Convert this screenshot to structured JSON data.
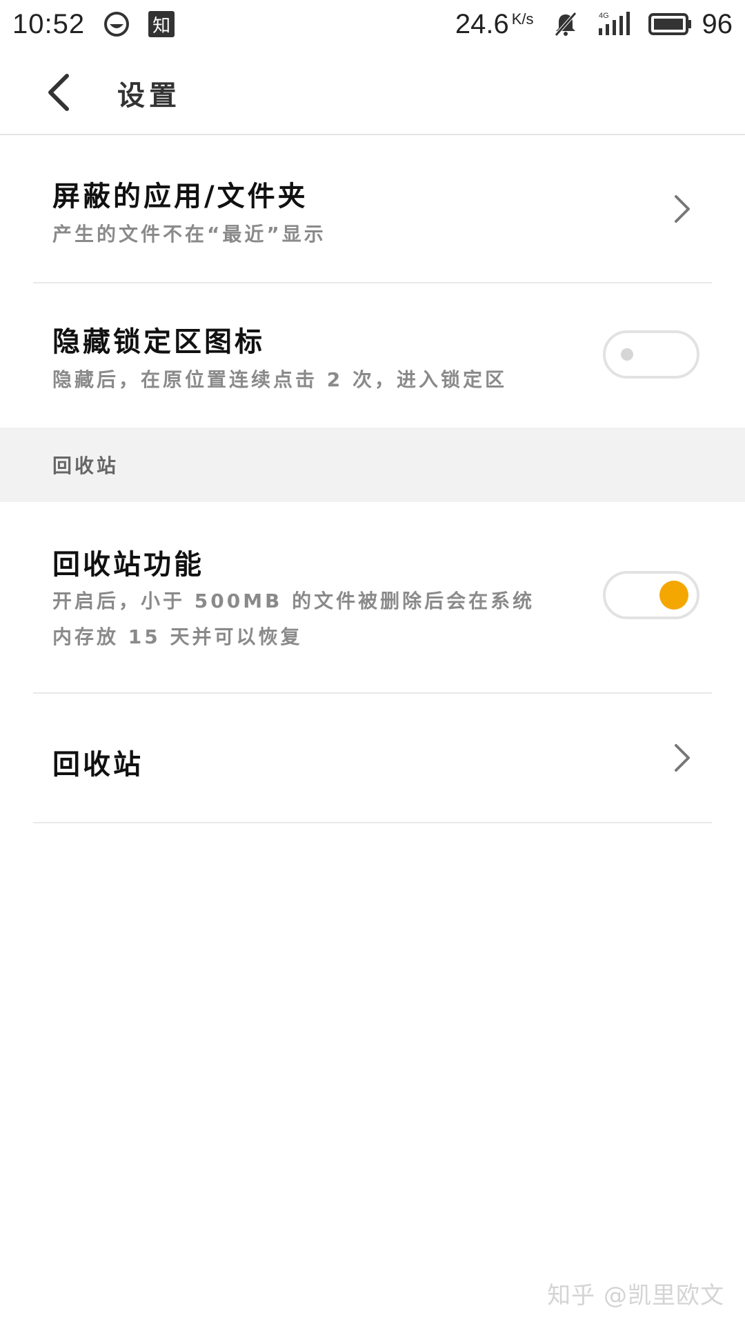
{
  "status_bar": {
    "time": "10:52",
    "zhi_badge": "知",
    "speed_value": "24.6",
    "speed_unit": "K/s",
    "battery": "96",
    "icons": [
      "face-icon",
      "zhihu-icon",
      "mute-bell-icon",
      "4g-signal-icon",
      "battery-icon"
    ]
  },
  "header": {
    "title": "设置"
  },
  "rows": [
    {
      "title": "屏蔽的应用/文件夹",
      "subtitle": "产生的文件不在“最近”显示",
      "control": "chevron"
    },
    {
      "title": "隐藏锁定区图标",
      "subtitle": "隐藏后，在原位置连续点击 2 次，进入锁定区",
      "control": "toggle",
      "toggle_state": "off"
    }
  ],
  "section": {
    "label": "回收站"
  },
  "recycle_rows": [
    {
      "title": "回收站功能",
      "subtitle_line1": "开启后，小于 500MB 的文件被删除后会在系统",
      "subtitle_line2": "内存放 15 天并可以恢复",
      "control": "toggle",
      "toggle_state": "on"
    },
    {
      "title": "回收站",
      "control": "chevron"
    }
  ],
  "colors": {
    "accent": "#f4a700",
    "divider": "#e8e8e8",
    "section_bg": "#f2f2f2"
  },
  "watermark": "知乎 @凯里欧文"
}
